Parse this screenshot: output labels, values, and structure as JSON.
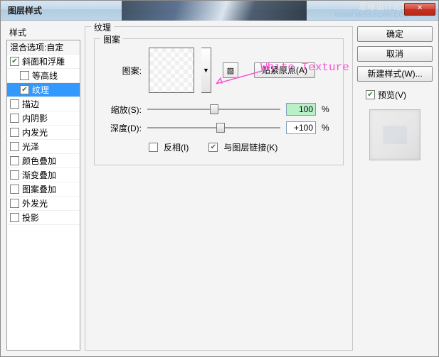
{
  "title": "图层样式",
  "watermark": {
    "line1": "思缘设计论坛",
    "line2": "WWW.MISSYUAN.COM"
  },
  "styles_header": "样式",
  "blend_header": "混合选项:自定",
  "style_items": [
    {
      "label": "斜面和浮雕",
      "checked": true,
      "selected": false,
      "indent": false
    },
    {
      "label": "等高线",
      "checked": false,
      "selected": false,
      "indent": true
    },
    {
      "label": "纹理",
      "checked": true,
      "selected": true,
      "indent": true
    },
    {
      "label": "描边",
      "checked": false,
      "selected": false,
      "indent": false
    },
    {
      "label": "内阴影",
      "checked": false,
      "selected": false,
      "indent": false
    },
    {
      "label": "内发光",
      "checked": false,
      "selected": false,
      "indent": false
    },
    {
      "label": "光泽",
      "checked": false,
      "selected": false,
      "indent": false
    },
    {
      "label": "颜色叠加",
      "checked": false,
      "selected": false,
      "indent": false
    },
    {
      "label": "渐变叠加",
      "checked": false,
      "selected": false,
      "indent": false
    },
    {
      "label": "图案叠加",
      "checked": false,
      "selected": false,
      "indent": false
    },
    {
      "label": "外发光",
      "checked": false,
      "selected": false,
      "indent": false
    },
    {
      "label": "投影",
      "checked": false,
      "selected": false,
      "indent": false
    }
  ],
  "center": {
    "legend_outer": "纹理",
    "legend_inner": "图案",
    "pattern_label": "图案:",
    "snap_btn": "贴紧原点(A)",
    "scale_label": "缩放(S):",
    "scale_value": "100",
    "scale_pct": 50,
    "depth_label": "深度(D):",
    "depth_value": "+100",
    "depth_pct": 55,
    "percent": "%",
    "invert_label": "反相(I)",
    "invert_checked": false,
    "link_label": "与图层链接(K)",
    "link_checked": true,
    "annotation": "White Texture"
  },
  "right": {
    "ok": "确定",
    "cancel": "取消",
    "new_style": "新建样式(W)...",
    "preview": "预览(V)",
    "preview_checked": true
  }
}
